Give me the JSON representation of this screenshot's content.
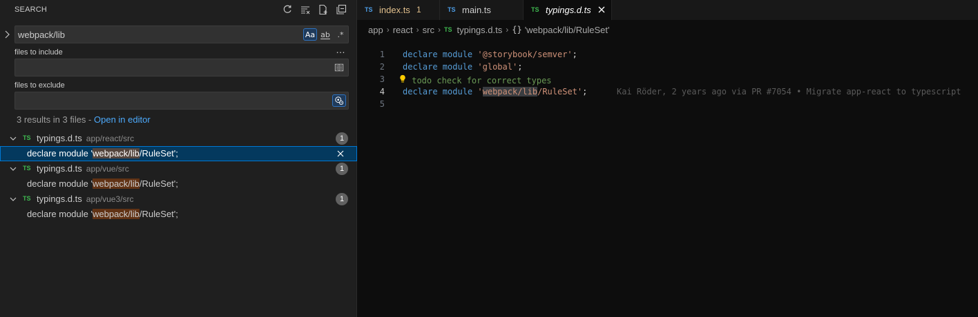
{
  "sidebar": {
    "title": "SEARCH",
    "search": {
      "value": "webpack/lib",
      "options": {
        "match_case": "Aa",
        "whole_word": "ab",
        "regex": ".*"
      }
    },
    "more_label": "…",
    "include": {
      "label": "files to include",
      "value": ""
    },
    "exclude": {
      "label": "files to exclude",
      "value": ""
    },
    "summary": {
      "text": "3 results in 3 files - ",
      "link": "Open in editor"
    },
    "results": [
      {
        "lang": "TS",
        "name": "typings.d.ts",
        "path": "app/react/src",
        "count": "1",
        "match": {
          "before": "declare module '",
          "hit": "webpack/lib",
          "after": "/RuleSet';"
        }
      },
      {
        "lang": "TS",
        "name": "typings.d.ts",
        "path": "app/vue/src",
        "count": "1",
        "match": {
          "before": "declare module '",
          "hit": "webpack/lib",
          "after": "/RuleSet';"
        }
      },
      {
        "lang": "TS",
        "name": "typings.d.ts",
        "path": "app/vue3/src",
        "count": "1",
        "match": {
          "before": "declare module '",
          "hit": "webpack/lib",
          "after": "/RuleSet';"
        }
      }
    ]
  },
  "tabs": [
    {
      "lang": "TS",
      "label": "index.ts",
      "badge": "1",
      "color": "#e2c08d"
    },
    {
      "lang": "TS",
      "label": "main.ts",
      "badge": "",
      "color": "#cccccc"
    },
    {
      "lang": "TS",
      "label": "typings.d.ts",
      "badge": "",
      "color": "#ffffff"
    }
  ],
  "breadcrumb": {
    "parts": [
      "app",
      "react",
      "src"
    ],
    "file_lang": "TS",
    "file": "typings.d.ts",
    "symbol_icon": "{}",
    "symbol": "'webpack/lib/RuleSet'"
  },
  "code": {
    "lines": [
      {
        "num": "1",
        "kw": "declare module",
        "str": "'@storybook/semver'",
        "end": ";"
      },
      {
        "num": "2",
        "kw": "declare module",
        "str": "'global'",
        "end": ";"
      },
      {
        "num": "3",
        "comment": "todo check for correct types"
      },
      {
        "num": "4",
        "kw": "declare module",
        "str_open": "'",
        "str_hit": "webpack/lib",
        "str_rest": "/RuleSet'",
        "end": ";"
      },
      {
        "num": "5"
      }
    ],
    "blame": "Kai Röder, 2 years ago via PR #7054 • Migrate app-react to typescript"
  },
  "colors": {
    "accent": "#0078d4",
    "ts_icon": "#3fb950",
    "ts_tab_icon": "#4d9ee8",
    "match_highlight": "#ea5c00"
  }
}
